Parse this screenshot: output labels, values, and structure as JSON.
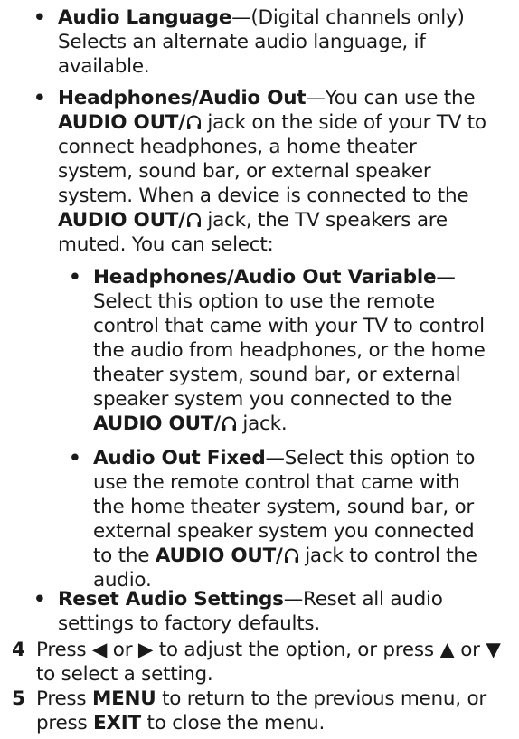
{
  "bullets": [
    {
      "title": "Audio Language",
      "body": "—(Digital channels only) Selects an alternate audio language, if available."
    },
    {
      "title": "Headphones/Audio Out",
      "body_1": "—You can use the",
      "jack_label": "AUDIO OUT/",
      "body_2": "jack on the side of your TV to connect headphones, a home theater system, sound bar, or external speaker system. When a device is connected to the",
      "body_3": "jack, the TV speakers are muted. You can select:"
    },
    {
      "title": "Reset Audio Settings",
      "body": "—Reset all audio settings to factory defaults."
    }
  ],
  "sub_bullets": [
    {
      "title": "Headphones/Audio Out Variable",
      "body_1": "—Select this option to use the remote control that came with your TV to control the audio from headphones, or the home theater system, sound bar, or external speaker system you connected to the",
      "body_2": "jack."
    },
    {
      "title": "Audio Out Fixed",
      "body_1": "—Select this option to use the remote control that came with the home theater system, sound bar, or external speaker system you connected to the",
      "body_2": "jack to control the audio."
    }
  ],
  "steps": [
    {
      "number": "4",
      "text": "Press ◀ or ▶ to adjust the option, or press ▲ or ▼ to select a setting."
    },
    {
      "number": "5",
      "text_1": "Press",
      "key_1": "MENU",
      "text_2": "to return to the previous menu, or press",
      "key_2": "EXIT",
      "text_3": "to close the menu."
    }
  ],
  "icons": {
    "headphones": "headphones-icon"
  }
}
